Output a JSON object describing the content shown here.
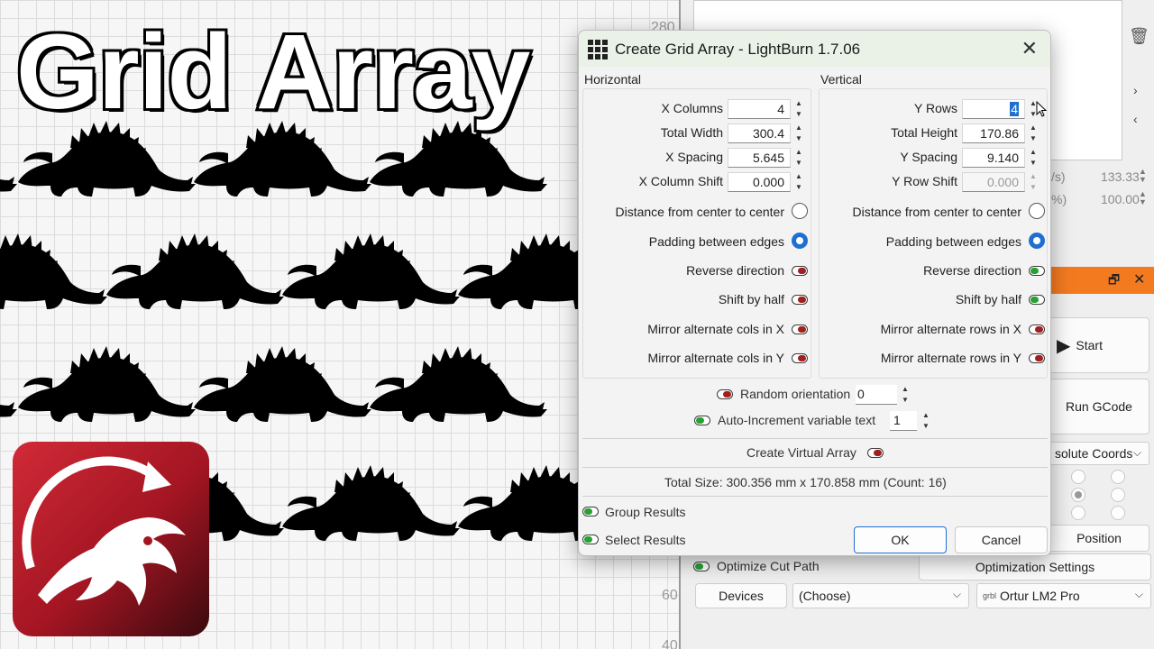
{
  "overlay": {
    "title": "Grid Array"
  },
  "canvas": {
    "ruler_top": "280",
    "ruler_bottom_a": "60",
    "ruler_bottom_b": "40"
  },
  "dialog": {
    "title": "Create Grid Array - LightBurn 1.7.06",
    "close_symbol": "✕",
    "horizontal": {
      "label": "Horizontal",
      "x_columns_label": "X Columns",
      "x_columns_value": "4",
      "total_width_label": "Total Width",
      "total_width_value": "300.4",
      "x_spacing_label": "X Spacing",
      "x_spacing_value": "5.645",
      "x_column_shift_label": "X Column Shift",
      "x_column_shift_value": "0.000",
      "distance_label": "Distance from center to center",
      "padding_label": "Padding between edges",
      "reverse_label": "Reverse direction",
      "shift_half_label": "Shift by half",
      "mirror_x_label": "Mirror alternate cols in X",
      "mirror_y_label": "Mirror alternate cols in Y"
    },
    "vertical": {
      "label": "Vertical",
      "y_rows_label": "Y Rows",
      "y_rows_value": "4",
      "total_height_label": "Total Height",
      "total_height_value": "170.86",
      "y_spacing_label": "Y Spacing",
      "y_spacing_value": "9.140",
      "y_row_shift_label": "Y Row Shift",
      "y_row_shift_value": "0.000",
      "distance_label": "Distance from center to center",
      "padding_label": "Padding between edges",
      "reverse_label": "Reverse direction",
      "shift_half_label": "Shift by half",
      "mirror_x_label": "Mirror alternate rows in X",
      "mirror_y_label": "Mirror alternate rows in Y"
    },
    "random_orientation_label": "Random orientation",
    "random_orientation_value": "0",
    "auto_increment_label": "Auto-Increment variable text",
    "auto_increment_value": "1",
    "virtual_array_label": "Create Virtual Array",
    "total_size_text": "Total Size: 300.356 mm x 170.858 mm  (Count: 16)",
    "group_results_label": "Group Results",
    "select_results_label": "Select Results",
    "ok_label": "OK",
    "cancel_label": "Cancel"
  },
  "right_panel": {
    "val_a_prefix": "/s)",
    "val_a": "133.33",
    "val_b_prefix": "%)",
    "val_b": "100.00",
    "start_label": "Start",
    "run_gcode_label": "Run GCode",
    "coords_label": "solute Coords",
    "position_label": "Position",
    "optimize_cut_label": "Optimize Cut Path",
    "optimization_settings_label": "Optimization Settings",
    "devices_label": "Devices",
    "choose_label": "(Choose)",
    "device_prefix": "grbl",
    "device_label": "Ortur LM2 Pro"
  },
  "colors": {
    "accent_blue": "#1f6fd1",
    "toggle_on": "#27a132",
    "toggle_off": "#a11f1f",
    "orange_bar": "#f47a20",
    "logo_red": "#b01d2a"
  }
}
